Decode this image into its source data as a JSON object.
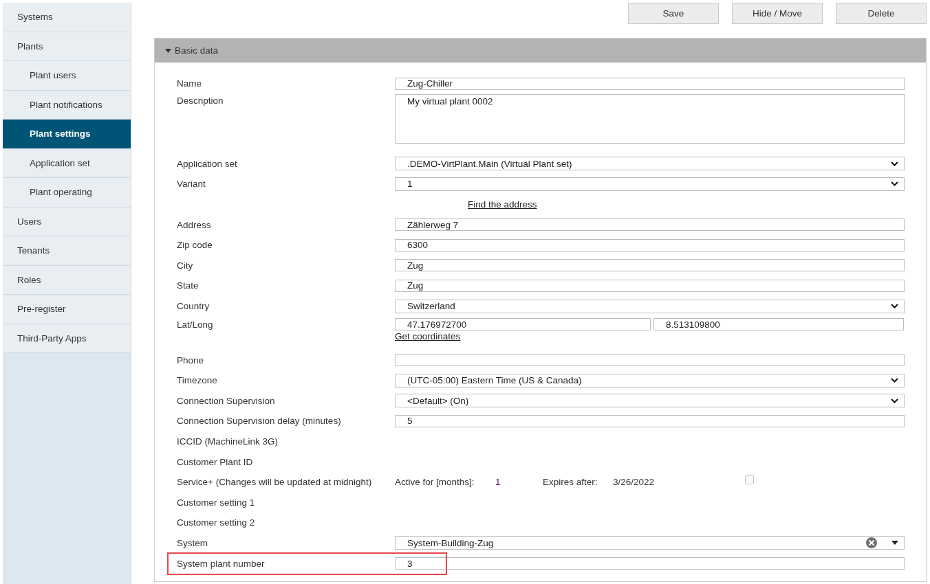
{
  "sidebar": {
    "items": [
      {
        "label": "Systems",
        "selected": false
      },
      {
        "label": "Plants",
        "selected": false,
        "children": [
          {
            "label": "Plant users",
            "selected": false
          },
          {
            "label": "Plant notifications",
            "selected": false
          },
          {
            "label": "Plant settings",
            "selected": true
          },
          {
            "label": "Application set",
            "selected": false
          },
          {
            "label": "Plant operating",
            "selected": false
          }
        ]
      },
      {
        "label": "Users",
        "selected": false
      },
      {
        "label": "Tenants",
        "selected": false
      },
      {
        "label": "Roles",
        "selected": false
      },
      {
        "label": "Pre-register",
        "selected": false
      },
      {
        "label": "Third-Party Apps",
        "selected": false
      }
    ]
  },
  "toolbar": {
    "buttons": [
      "Save",
      "Hide / Move",
      "Delete"
    ]
  },
  "panel": {
    "title": "Basic data",
    "expanded": true,
    "rows": [
      {
        "kind": "text",
        "label": "Name",
        "value": "Zug-Chiller"
      },
      {
        "kind": "textarea",
        "label": "Description",
        "value": "My virtual plant 0002"
      },
      {
        "kind": "select",
        "label": "Application set",
        "value": ".DEMO-VirtPlant.Main (Virtual Plant set)"
      },
      {
        "kind": "select",
        "label": "Variant",
        "value": "1"
      },
      {
        "kind": "link",
        "link": "Find the address"
      },
      {
        "kind": "text",
        "label": "Address",
        "value": "Zählerweg 7"
      },
      {
        "kind": "text",
        "label": "Zip code",
        "value": "6300"
      },
      {
        "kind": "text",
        "label": "City",
        "value": "Zug"
      },
      {
        "kind": "text",
        "label": "State",
        "value": "Zug"
      },
      {
        "kind": "select",
        "label": "Country",
        "value": "Switzerland"
      },
      {
        "kind": "latlong",
        "label": "Lat/Long",
        "lat": "47.176972700",
        "long": "8.513109800",
        "link": "Get coordinates"
      },
      {
        "kind": "text",
        "label": "Phone",
        "value": ""
      },
      {
        "kind": "select",
        "label": "Timezone",
        "value": "(UTC-05:00) Eastern Time (US & Canada)"
      },
      {
        "kind": "select",
        "label": "Connection Supervision",
        "value": "<Default> (On)"
      },
      {
        "kind": "text",
        "label": "Connection Supervision delay (minutes)",
        "value": "5"
      },
      {
        "kind": "plain",
        "label": "ICCID (MachineLink 3G)"
      },
      {
        "kind": "plain",
        "label": "Customer Plant ID"
      },
      {
        "kind": "service",
        "label": "Service+ (Changes will be updated at midnight)",
        "active_label": "Active for [months]:",
        "active_value": "1",
        "expires_label": "Expires after:",
        "expires_value": "3/26/2022",
        "checked": false
      },
      {
        "kind": "plain",
        "label": "Customer setting 1"
      },
      {
        "kind": "plain",
        "label": "Customer setting 2"
      },
      {
        "kind": "combo",
        "label": "System",
        "value": "System-Building-Zug"
      },
      {
        "kind": "text",
        "label": "System plant number",
        "value": "3",
        "highlighted": true
      }
    ]
  }
}
